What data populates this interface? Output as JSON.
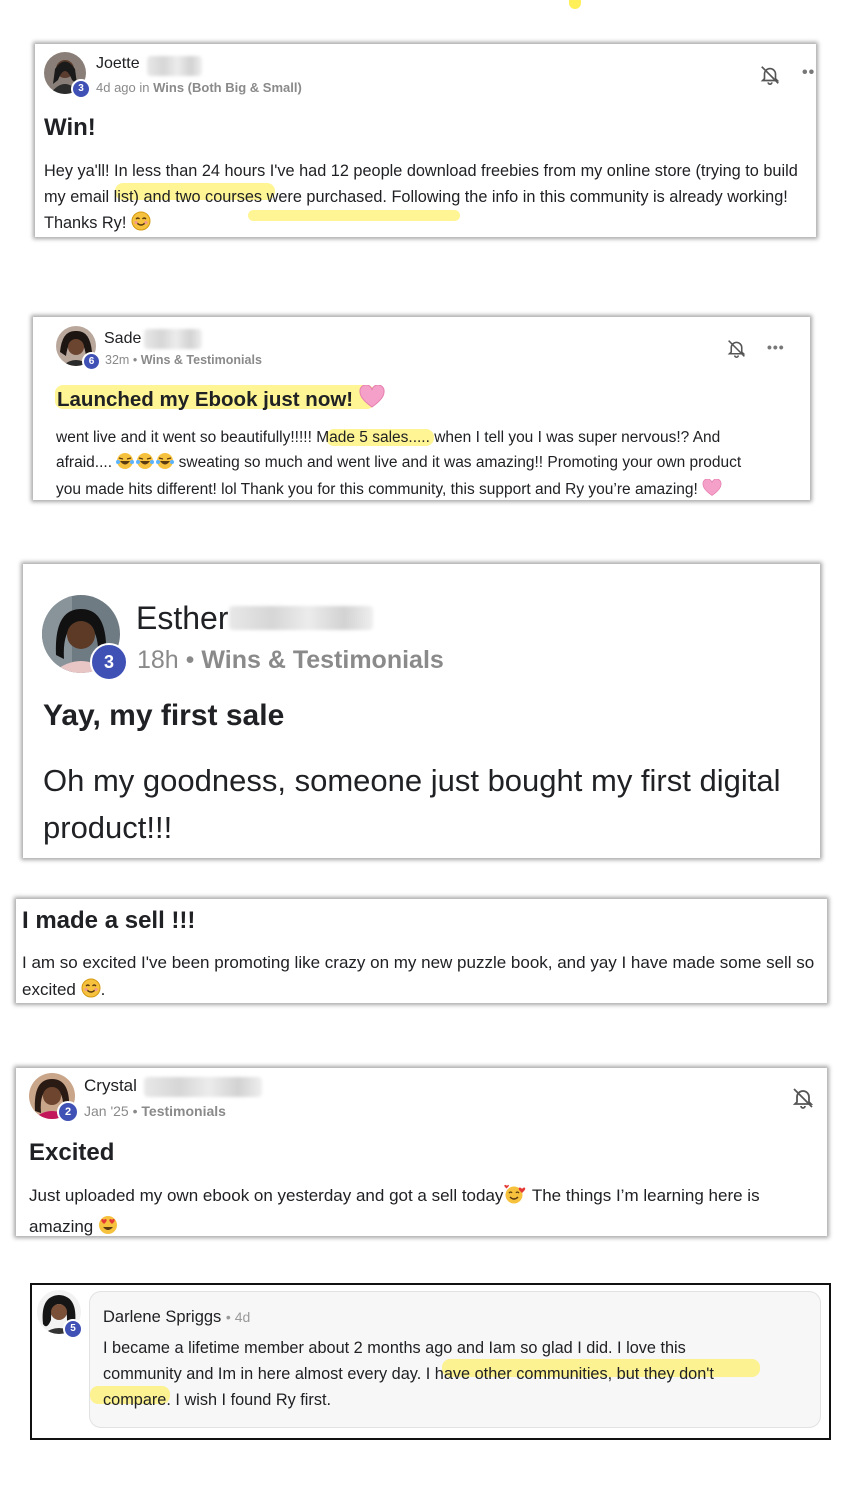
{
  "posts": [
    {
      "author": "Joette",
      "level": "3",
      "time": "4d ago in",
      "category": "Wins (Both Big & Small)",
      "title": "Win!",
      "body": "Hey ya'll! In less than 24 hours I've had 12 people download freebies from my online store (trying to build my email list) and two courses were purchased. Following the info in this community is already working! Thanks Ry!"
    },
    {
      "author": "Sade",
      "level": "6",
      "time": "32m",
      "category": "Wins & Testimonials",
      "title": "Launched my Ebook just now!",
      "body_line1": "went live and it went so beautifully!!!!! Made 5 sales..... when I tell you I was super nervous!? And",
      "body_line2": "afraid....",
      "body_line2b": "sweating so much and went live and it was amazing!! Promoting your own product",
      "body_line3": "you made hits different! lol Thank you for this community, this support and Ry you’re amazing!"
    },
    {
      "author": "Esther",
      "level": "3",
      "time": "18h",
      "category": "Wins & Testimonials",
      "title": "Yay, my first sale",
      "body": "Oh my goodness, someone just bought my first digital product!!!"
    },
    {
      "title": "I made a sell !!!",
      "body": "I am so excited I've been promoting like crazy on my new puzzle book, and yay I have made some sell so excited",
      "body_end": "."
    },
    {
      "author": "Crystal",
      "level": "2",
      "time": "Jan '25",
      "category": "Testimonials",
      "title": "Excited",
      "body_line1": "Just uploaded my own ebook on yesterday and got a sell today",
      "body_line1b": "The things I’m learning here is",
      "body_line2": "amazing"
    },
    {
      "author": "Darlene Spriggs",
      "level": "5",
      "time": "4d",
      "body": "I became a lifetime member about 2 months ago and Iam so glad I did. I love this community and Im in here almost every day. I have other communities, but they don't compare. I wish I found Ry first."
    }
  ],
  "separator": "•",
  "colors": {
    "highlight": "#fff05a",
    "level_badge": "#3f51b5",
    "meta_text": "#8a8a8a"
  },
  "icons": [
    "bell-off-icon",
    "more-dots-icon",
    "heart-icon",
    "smile-icon",
    "laugh-tears-icon",
    "heart-eyes-icon",
    "smiling-hearts-icon"
  ]
}
